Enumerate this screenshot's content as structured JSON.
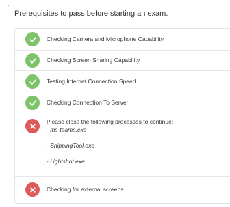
{
  "heading": "Prerequisites to pass before starting an exam.",
  "colors": {
    "success": "#7cc36a",
    "failure": "#dc5a5a",
    "border": "#e2e2e2"
  },
  "checks": [
    {
      "label": "Checking Camera and Microphone Capability",
      "status": "passed",
      "icon": "check-icon"
    },
    {
      "label": "Checking Screen Sharing Capability",
      "status": "passed",
      "icon": "check-icon"
    },
    {
      "label": "Testing Internet Connection Speed",
      "status": "passed",
      "icon": "check-icon"
    },
    {
      "label": "Checking Connection To Server",
      "status": "passed",
      "icon": "check-icon"
    },
    {
      "label": "Please close the following processes to continue:",
      "status": "failed",
      "icon": "x-icon",
      "processes": [
        {
          "prefix": "- ",
          "name": "ms-teams.exe"
        },
        {
          "prefix": "- ",
          "name": "SnippingTool.exe"
        },
        {
          "prefix": "- ",
          "name": "Lightshot.exe"
        }
      ]
    },
    {
      "label": "Checking for external screens",
      "status": "failed",
      "icon": "x-icon"
    }
  ]
}
